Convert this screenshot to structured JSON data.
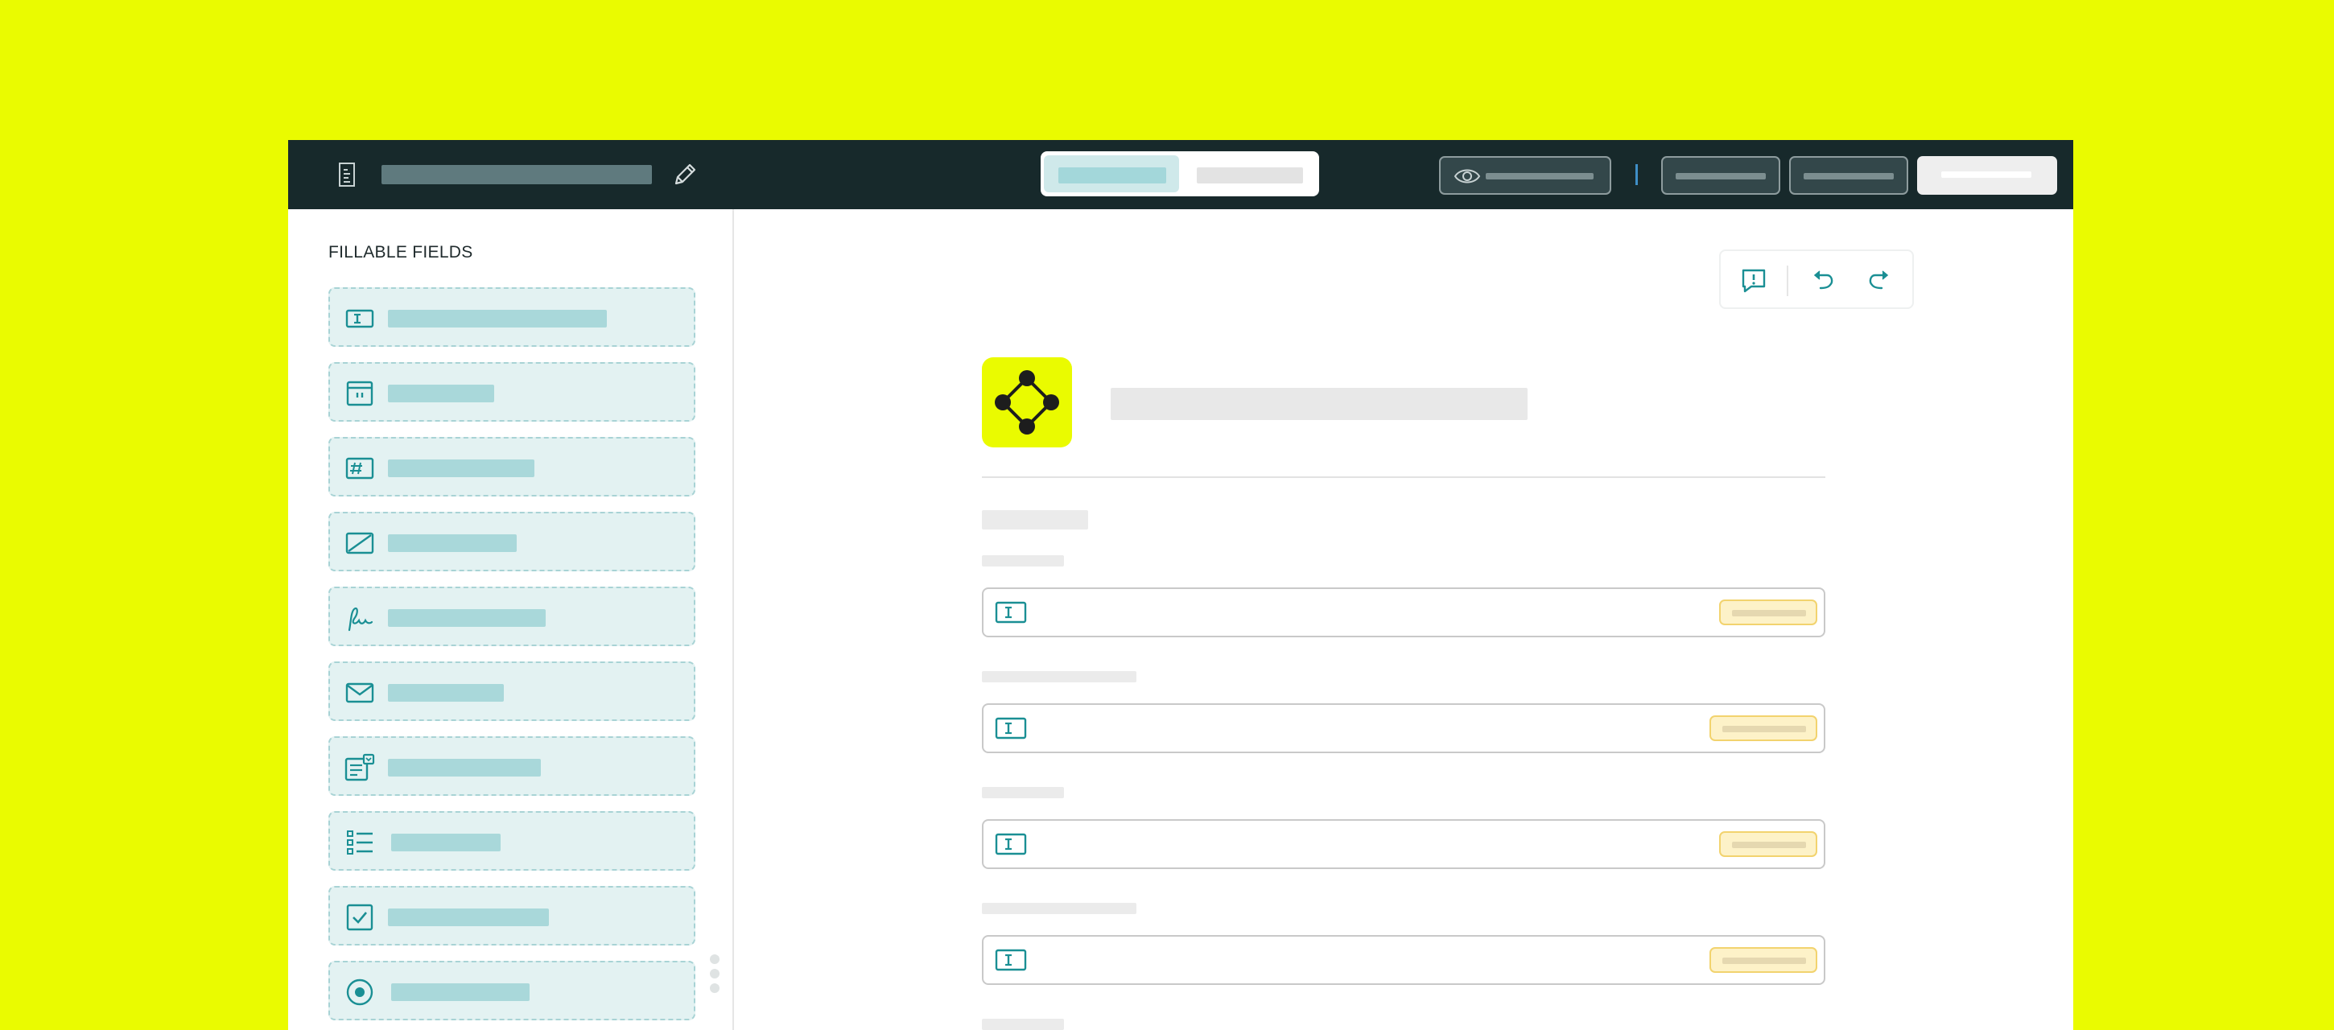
{
  "sidebar": {
    "heading": "FILLABLE FIELDS",
    "items": [
      {
        "icon": "text-field-icon"
      },
      {
        "icon": "date-field-icon"
      },
      {
        "icon": "number-field-icon"
      },
      {
        "icon": "initials-field-icon"
      },
      {
        "icon": "signature-field-icon"
      },
      {
        "icon": "email-field-icon"
      },
      {
        "icon": "dropdown-field-icon"
      },
      {
        "icon": "list-field-icon"
      },
      {
        "icon": "checkbox-field-icon"
      },
      {
        "icon": "radio-field-icon"
      }
    ]
  },
  "colors": {
    "background": "#eafb00",
    "topbar": "#17292b",
    "accent": "#1a8f94",
    "field_fill": "#e3f2f2",
    "badge_fill": "#fdf2c8",
    "badge_border": "#f2d36e"
  },
  "icons": {
    "topbar": [
      "document-icon",
      "pencil-icon",
      "eye-icon"
    ],
    "canvas_tools": [
      "feedback-icon",
      "undo-icon",
      "redo-icon"
    ],
    "form_logo": "network-diamond-logo",
    "form_fields": [
      "text-field-icon",
      "text-field-icon",
      "text-field-icon",
      "text-field-icon"
    ]
  }
}
